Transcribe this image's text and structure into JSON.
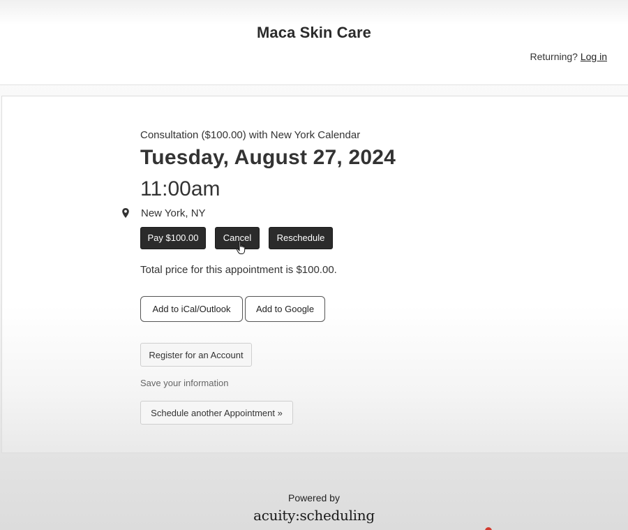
{
  "header": {
    "business_name": "Maca Skin Care",
    "returning_label": "Returning?",
    "login_link": "Log in"
  },
  "appointment": {
    "service_line": "Consultation ($100.00) with New York Calendar",
    "date": "Tuesday, August 27, 2024",
    "time": "11:00am",
    "location": "New York, NY",
    "location_icon": "map-pin-icon"
  },
  "actions": {
    "pay_label": "Pay $100.00",
    "cancel_label": "Cancel",
    "reschedule_label": "Reschedule"
  },
  "total_text": "Total price for this appointment is $100.00.",
  "calendar": {
    "ical_label": "Add to iCal/Outlook",
    "google_label": "Add to Google"
  },
  "account": {
    "register_label": "Register for an Account",
    "save_info": "Save your information",
    "schedule_another_label": "Schedule another Appointment »"
  },
  "footer": {
    "powered_by": "Powered by",
    "logo_text": "acuity:scheduling"
  },
  "colors": {
    "button_dark": "#2b2b2b",
    "text": "#333333"
  }
}
